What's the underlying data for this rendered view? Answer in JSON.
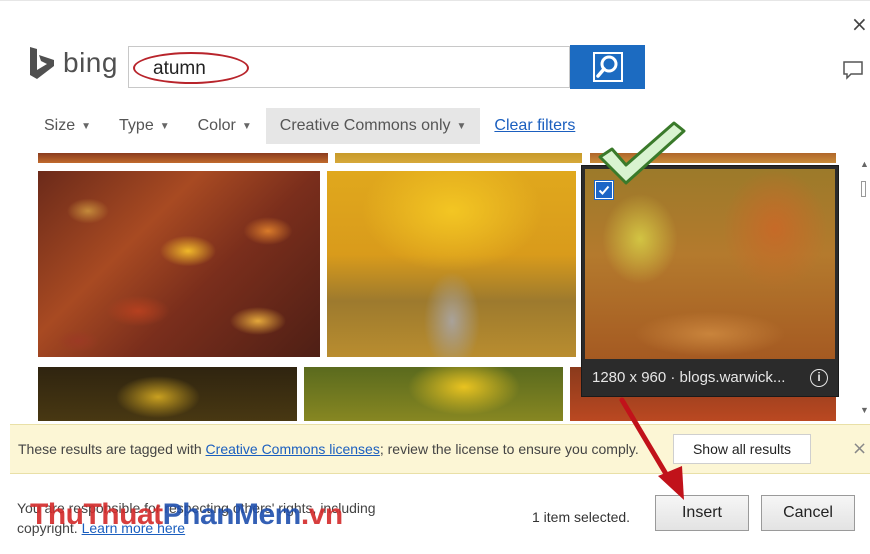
{
  "dialog": {
    "close_symbol": "×",
    "feedback_icon": "speech-bubble-icon"
  },
  "brand": {
    "name": "bing",
    "logo_icon": "bing-logo-icon"
  },
  "search": {
    "value": "atumn",
    "button_icon": "magnifier-icon",
    "accent_color": "#1c6bc1",
    "highlight_color": "#b8242b"
  },
  "filters": {
    "size": "Size",
    "type": "Type",
    "color": "Color",
    "creative_commons": "Creative Commons only",
    "clear": "Clear filters"
  },
  "selected_image": {
    "meta": "1280 x 960 · blogs.warwick...",
    "checked": true
  },
  "notice": {
    "prefix": "These results are tagged with ",
    "link": "Creative Commons licenses",
    "suffix": "; review the license to ensure you comply.",
    "show_all": "Show all results",
    "close_symbol": "×"
  },
  "footer": {
    "text": "You are responsible for respecting others' rights, including copyright.",
    "link": "Learn more here",
    "selected_count": "1 item selected.",
    "insert": "Insert",
    "cancel": "Cancel"
  },
  "watermark": {
    "part1": "ThuThuat",
    "part2": "PhanMem",
    "part3": ".vn"
  }
}
